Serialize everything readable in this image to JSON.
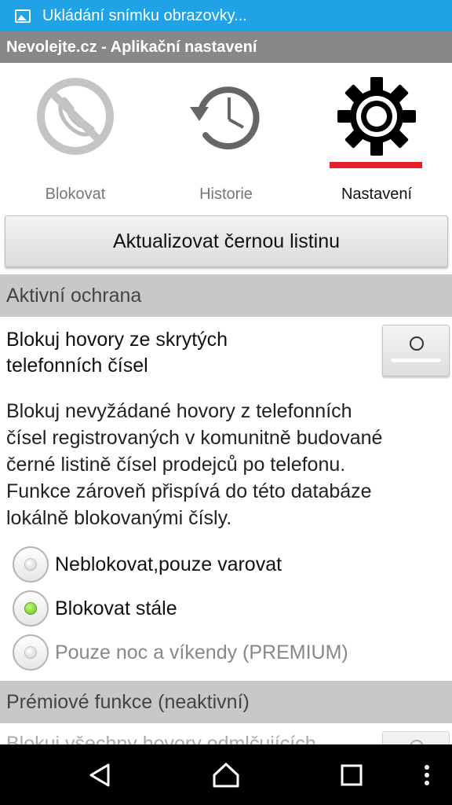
{
  "status_bar": {
    "notification_icon": "image-icon",
    "text": "Ukládání snímku obrazovky..."
  },
  "title_bar": {
    "title": "Nevolejte.cz - Aplikační nastavení"
  },
  "tabs": [
    {
      "label": "Blokovat",
      "icon": "blocked-phone-icon",
      "active": false
    },
    {
      "label": "Historie",
      "icon": "history-clock-icon",
      "active": false
    },
    {
      "label": "Nastavení",
      "icon": "gear-icon",
      "active": true
    }
  ],
  "update_button": {
    "label": "Aktualizovat černou listinu"
  },
  "sections": {
    "active": {
      "header": "Aktivní ochrana",
      "hidden_numbers": {
        "line1": "Blokuj hovory ze skrytých",
        "line2": "telefonních čísel",
        "toggle_on": false
      },
      "description": {
        "line1": "Blokuj nevyžádané hovory z telefonních",
        "line2": "čísel registrovaných v komunitně budované",
        "line3": "černé listině čísel prodejců po telefonu.",
        "line4": "Funkce zároveň přispívá do této databáze",
        "line5": "lokálně blokovanými čísly."
      },
      "options": [
        {
          "label": "Neblokovat,pouze varovat",
          "selected": false,
          "enabled": true
        },
        {
          "label": "Blokovat stále",
          "selected": true,
          "enabled": true
        },
        {
          "label": "Pouze noc a víkendy (PREMIUM)",
          "selected": false,
          "enabled": false
        }
      ]
    },
    "premium": {
      "header": "Prémiové funkce (neaktivní)",
      "partial_row": "Blokuj všechny hovory odmlčujících"
    }
  },
  "colors": {
    "status_bar": "#1fa3e6",
    "title_bar": "#888888",
    "tab_indicator": "#e8202a",
    "section_header": "#c8c8c8",
    "radio_selected": "#5fbf1a"
  },
  "nav_bar": {
    "back": "back-icon",
    "home": "home-icon",
    "recents": "recents-icon",
    "menu": "overflow-menu-icon"
  }
}
